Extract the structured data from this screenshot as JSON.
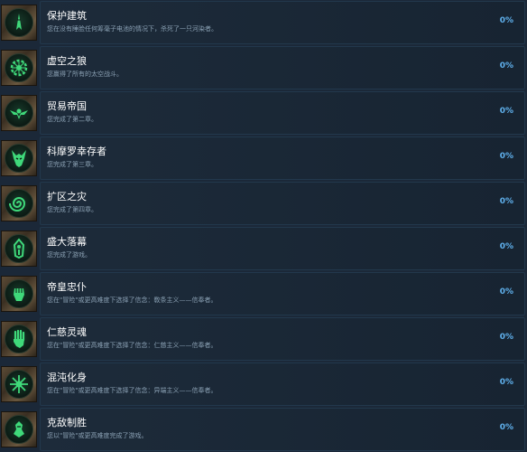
{
  "accent_color": "#5fb0ec",
  "icon_color": "#3fd97a",
  "achievements": [
    {
      "title": "保护建筑",
      "desc": "您在没有睡脸任何筹毫子电池的情况下，杀死了一只河染者。",
      "percent": "0%",
      "icon": "spire-icon"
    },
    {
      "title": "虚空之狼",
      "desc": "您赢得了所有的太空战斗。",
      "percent": "0%",
      "icon": "gear-star-icon"
    },
    {
      "title": "贸易帝国",
      "desc": "您完成了第二章。",
      "percent": "0%",
      "icon": "winged-skull-icon"
    },
    {
      "title": "科摩罗幸存者",
      "desc": "您完成了第三章。",
      "percent": "0%",
      "icon": "demon-mask-icon"
    },
    {
      "title": "扩区之灾",
      "desc": "您完成了第四章。",
      "percent": "0%",
      "icon": "spiral-icon"
    },
    {
      "title": "盛大落幕",
      "desc": "您完成了游戏。",
      "percent": "0%",
      "icon": "hooded-figure-icon"
    },
    {
      "title": "帝皇忠仆",
      "desc": "您在\"冒险\"或更高难度下选择了信念：敎条主义——信奉者。",
      "percent": "0%",
      "icon": "fist-icon"
    },
    {
      "title": "仁慈灵魂",
      "desc": "您在\"冒险\"或更高难度下选择了信念：仁慈主义——信奉者。",
      "percent": "0%",
      "icon": "open-hand-icon"
    },
    {
      "title": "混沌化身",
      "desc": "您在\"冒险\"或更高难度下选择了信念：异端主义——信奉者。",
      "percent": "0%",
      "icon": "chaos-star-icon"
    },
    {
      "title": "克敌制胜",
      "desc": "您以\"冒险\"或更高难度完成了游戏。",
      "percent": "0%",
      "icon": "armored-warrior-icon"
    }
  ]
}
